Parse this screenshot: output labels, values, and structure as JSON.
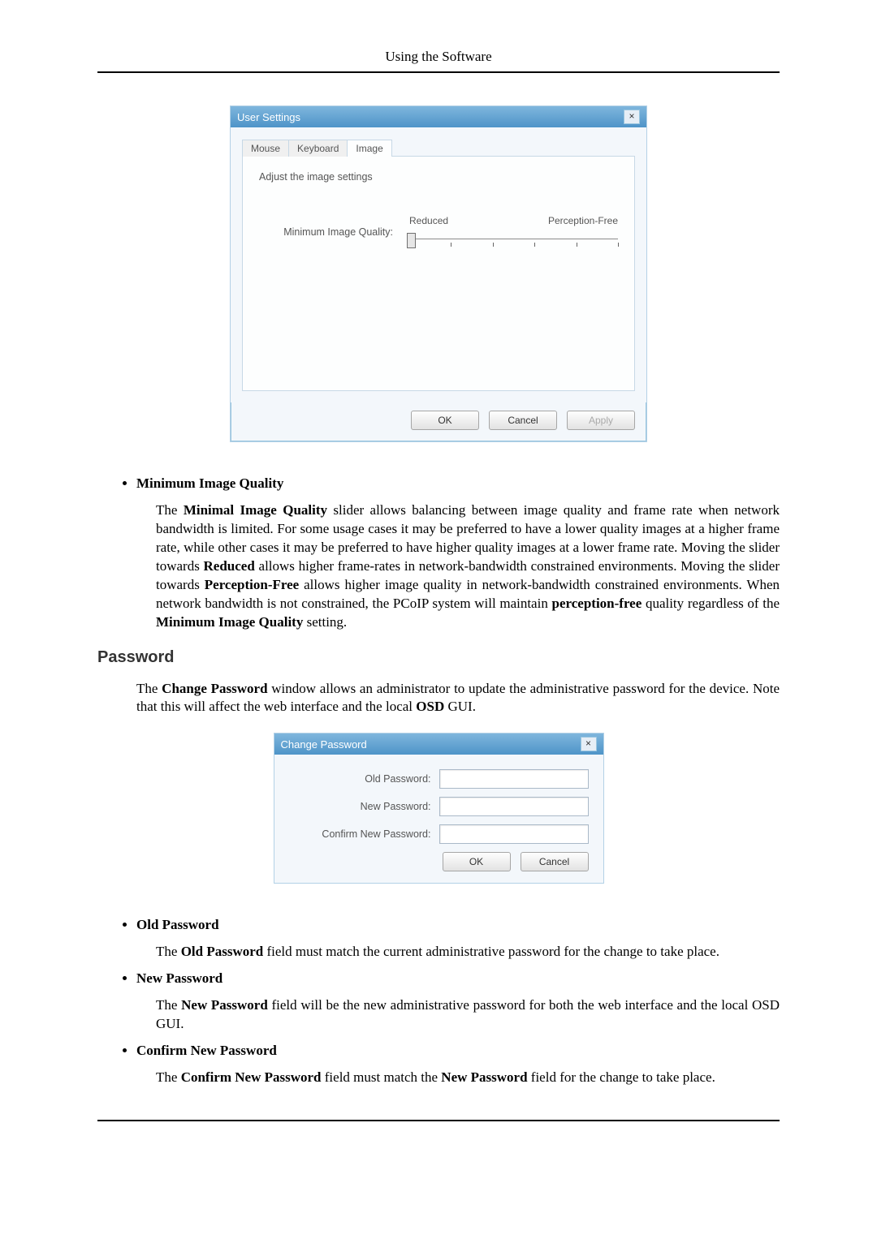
{
  "header": {
    "title": "Using the Software"
  },
  "user_settings": {
    "window_title": "User Settings",
    "tabs": {
      "mouse": "Mouse",
      "keyboard": "Keyboard",
      "image": "Image"
    },
    "description": "Adjust the image settings",
    "slider": {
      "label": "Minimum Image Quality:",
      "left": "Reduced",
      "right": "Perception-Free"
    },
    "buttons": {
      "ok": "OK",
      "cancel": "Cancel",
      "apply": "Apply"
    }
  },
  "change_password": {
    "window_title": "Change Password",
    "fields": {
      "old": "Old Password:",
      "new": "New Password:",
      "confirm": "Confirm New Password:"
    },
    "buttons": {
      "ok": "OK",
      "cancel": "Cancel"
    }
  },
  "content": {
    "miq": {
      "title": "Minimum Image Quality",
      "p_a": "The ",
      "p_b": "Minimal Image Quality",
      "p_c": " slider allows balancing between image quality and frame rate when network bandwidth is limited. For some usage cases it may be preferred to have a lower quality images at a higher frame rate, while other cases it may be preferred to have higher quality images at a lower frame rate. Moving the slider towards ",
      "p_d": "Reduced",
      "p_e": " allows higher frame-rates in network-bandwidth constrained environments. Moving the slider towards ",
      "p_f": "Perception-Free",
      "p_g": " allows higher image quality in network-bandwidth constrained environments. When network bandwidth is not constrained, the PCoIP system will maintain ",
      "p_h": "perception-free",
      "p_i": " quality regardless of the ",
      "p_j": "Minimum Image Quality",
      "p_k": " setting."
    },
    "password_section": {
      "heading": "Password",
      "intro_a": "The ",
      "intro_b": "Change Password",
      "intro_c": " window allows an administrator to update the administrative password for the device. Note that this will affect the web interface and the local ",
      "intro_d": "OSD",
      "intro_e": " GUI."
    },
    "old_pw": {
      "title": "Old Password",
      "p_a": "The ",
      "p_b": "Old Password",
      "p_c": " field must match the current administrative password for the change to take place."
    },
    "new_pw": {
      "title": "New Password",
      "p_a": "The ",
      "p_b": "New Password",
      "p_c": " field will be the new administrative password for both the web interface and the local OSD GUI."
    },
    "confirm_pw": {
      "title": "Confirm New Password",
      "p_a": "The ",
      "p_b": "Confirm New Password",
      "p_c": " field must match the ",
      "p_d": "New Password",
      "p_e": " field for the change to take place."
    }
  }
}
